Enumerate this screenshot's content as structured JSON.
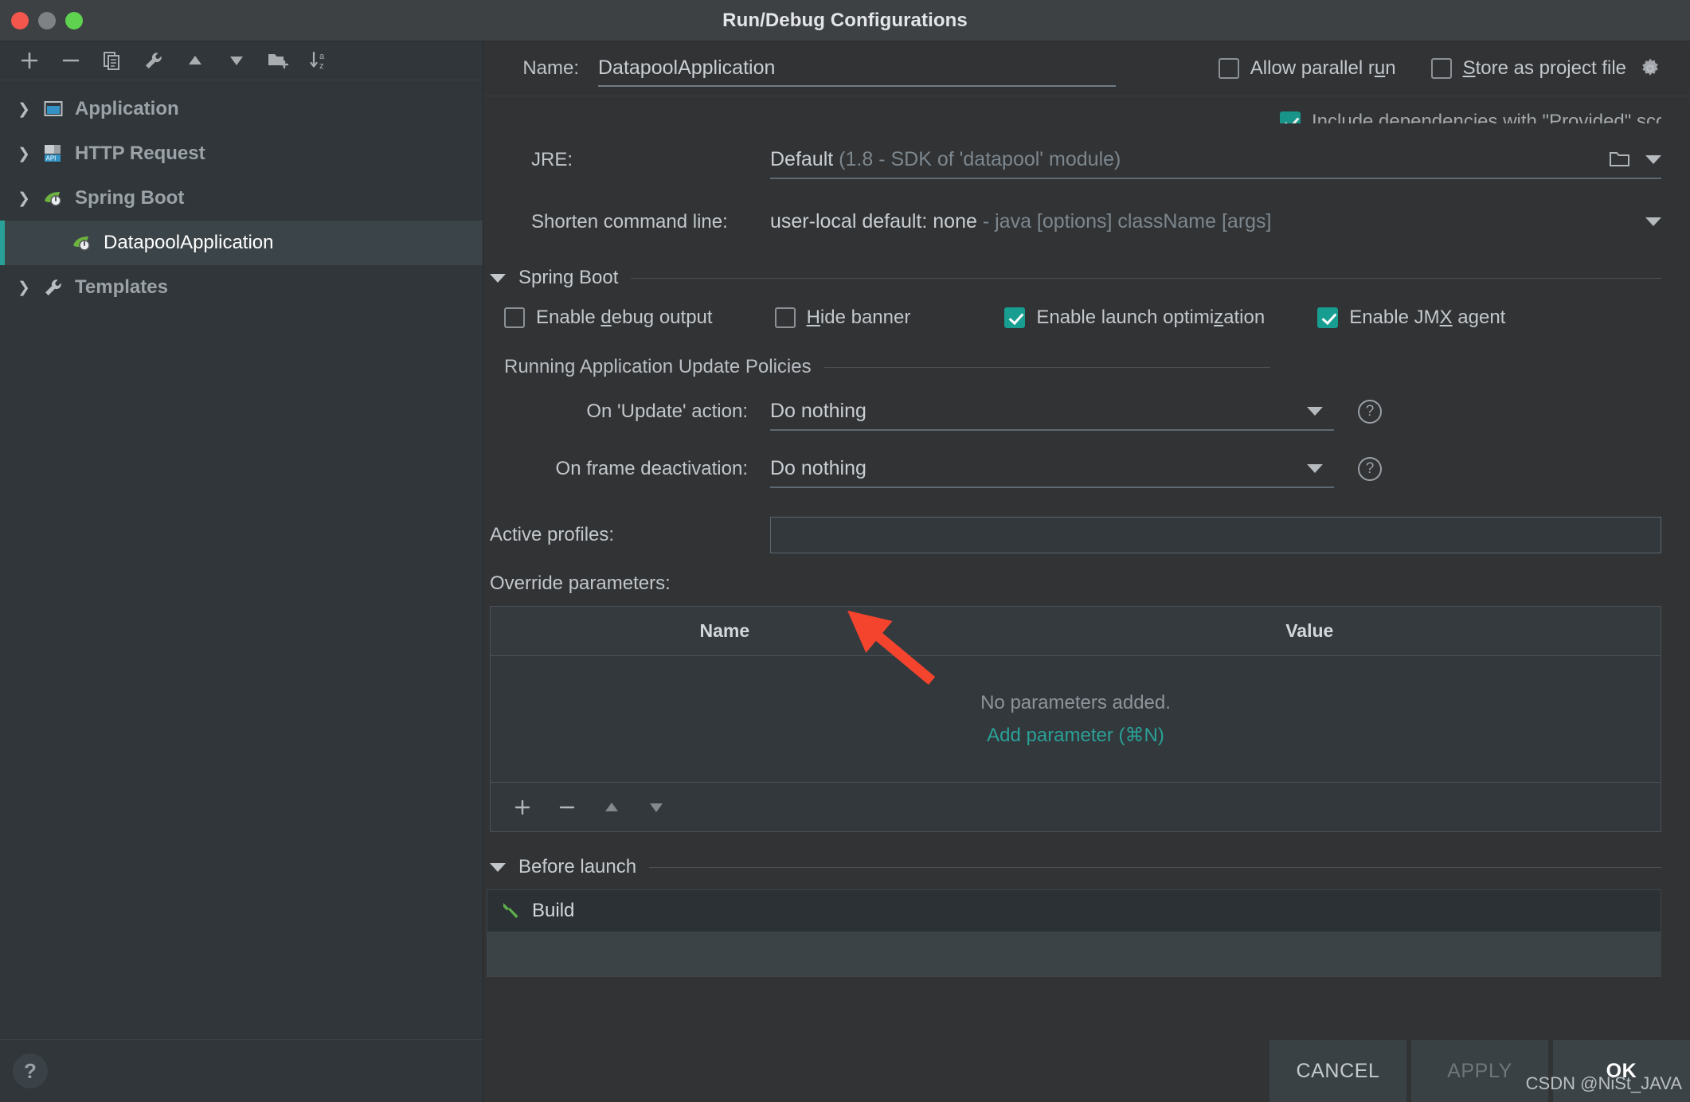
{
  "window": {
    "title": "Run/Debug Configurations",
    "traffic_lights": [
      "close",
      "minimize",
      "zoom"
    ]
  },
  "sidebar": {
    "toolbar": [
      {
        "name": "add-configuration",
        "icon": "plus-icon"
      },
      {
        "name": "remove-configuration",
        "icon": "minus-icon"
      },
      {
        "name": "copy-configuration",
        "icon": "copy-icon"
      },
      {
        "name": "edit-templates",
        "icon": "wrench-icon"
      },
      {
        "name": "move-up",
        "icon": "arrow-up-icon"
      },
      {
        "name": "move-down",
        "icon": "arrow-down-icon"
      },
      {
        "name": "create-folder",
        "icon": "folder-add-icon"
      },
      {
        "name": "sort-configurations",
        "icon": "sort-alpha-icon"
      }
    ],
    "tree": [
      {
        "label": "Application",
        "icon": "application-icon",
        "expanded": false,
        "selected": false,
        "level": 0
      },
      {
        "label": "HTTP Request",
        "icon": "http-request-icon",
        "expanded": false,
        "selected": false,
        "level": 0
      },
      {
        "label": "Spring Boot",
        "icon": "spring-boot-icon",
        "expanded": true,
        "selected": false,
        "level": 0
      },
      {
        "label": "DatapoolApplication",
        "icon": "spring-boot-icon",
        "expanded": null,
        "selected": true,
        "level": 1
      },
      {
        "label": "Templates",
        "icon": "wrench-icon",
        "expanded": false,
        "selected": false,
        "level": 0
      }
    ],
    "help_button": "?"
  },
  "header": {
    "name_label": "Name:",
    "name_value": "DatapoolApplication",
    "allow_parallel_run": {
      "label_pre": "Allow parallel r",
      "mnemonic": "u",
      "label_post": "n",
      "checked": false
    },
    "store_as_project_file": {
      "mnemonic": "S",
      "label_post": "tore as project file",
      "checked": false
    },
    "gear_icon": "gear-icon"
  },
  "form": {
    "clipped_checkbox": {
      "label": "Include dependencies with \"Provided\" scope",
      "checked": true
    },
    "jre": {
      "label": "JRE:",
      "value_bold": "Default",
      "value_muted": "(1.8 - SDK of 'datapool' module)"
    },
    "shorten_command_line": {
      "label": "Shorten command line:",
      "value_bold": "user-local default: none",
      "value_muted": "- java [options] className [args]"
    }
  },
  "spring_boot_section": {
    "title": "Spring Boot",
    "checkboxes": [
      {
        "name": "enable-debug-output",
        "pre": "Enable ",
        "mnemonic": "d",
        "post": "ebug output",
        "checked": false
      },
      {
        "name": "hide-banner",
        "pre": "",
        "mnemonic": "H",
        "post": "ide banner",
        "checked": false
      },
      {
        "name": "enable-launch-optimization",
        "pre": "Enable launch optimi",
        "mnemonic": "z",
        "post": "ation",
        "checked": true
      },
      {
        "name": "enable-jmx-agent",
        "pre": "Enable JM",
        "mnemonic": "X",
        "post": " agent",
        "checked": true
      }
    ],
    "update_policies": {
      "title": "Running Application Update Policies",
      "on_update_action": {
        "label": "On 'Update' action:",
        "value": "Do nothing"
      },
      "on_frame_deactivation": {
        "label": "On frame deactivation:",
        "value": "Do nothing"
      }
    },
    "active_profiles": {
      "label": "Active profiles:",
      "value": "",
      "placeholder": ""
    },
    "override_parameters": {
      "label": "Override parameters:",
      "columns": [
        "Name",
        "Value"
      ],
      "rows": [],
      "empty_text": "No parameters added.",
      "add_link": "Add parameter (⌘N)",
      "toolbar": [
        {
          "name": "add-parameter",
          "icon": "plus-icon"
        },
        {
          "name": "remove-parameter",
          "icon": "minus-icon"
        },
        {
          "name": "move-parameter-up",
          "icon": "arrow-up-icon"
        },
        {
          "name": "move-parameter-down",
          "icon": "arrow-down-icon"
        }
      ]
    }
  },
  "before_launch": {
    "title": "Before launch",
    "items": [
      {
        "label": "Build",
        "icon": "hammer-icon"
      }
    ]
  },
  "footer": {
    "cancel": "CANCEL",
    "apply": "APPLY",
    "ok": "OK",
    "watermark": "CSDN @NiSt_JAVA"
  },
  "colors": {
    "accent_teal": "#2aa198",
    "checkbox_checked": "#189d91",
    "annotation_red": "#f4442e",
    "spring_green": "#6cb33f",
    "background": "#313335",
    "sidebar_background": "#30363a"
  }
}
